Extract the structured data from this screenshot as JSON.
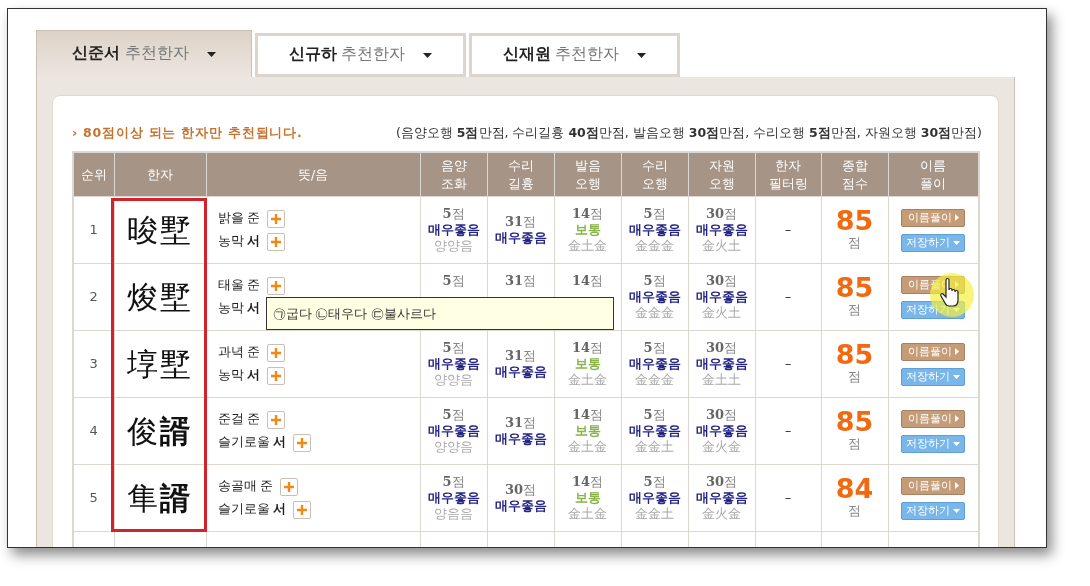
{
  "tabs": [
    {
      "label": "**신준서** 추천한자",
      "selected": true
    },
    {
      "label": "**신규하** 추천한자",
      "selected": false
    },
    {
      "label": "**신재원** 추천한자",
      "selected": false
    }
  ],
  "notice": "› 80점이상 되는 한자만 추천됩니다.",
  "score_legend": "(음양오행 **5점**만점, 수리길흉 **40점**만점, 발음오행 **30점**만점, 수리오행 **5점**만점, 자원오행 **30점**만점)",
  "table": {
    "columns": [
      {
        "label": "순위"
      },
      {
        "label": "한자"
      },
      {
        "label": "뜻/음"
      },
      {
        "label": "음양\n조화"
      },
      {
        "label": "수리\n길흉"
      },
      {
        "label": "발음\n오행"
      },
      {
        "label": "수리\n오행"
      },
      {
        "label": "자원\n오행"
      },
      {
        "label": "한자\n필터링"
      },
      {
        "label": "종합\n점수"
      },
      {
        "label": "이름\n풀이"
      }
    ],
    "hanja_highlight": true,
    "rows": [
      {
        "rank": "1",
        "hanja": "晙墅",
        "hovered": false,
        "meanings": [
          {
            "text": "밝을 준",
            "plus": true
          },
          {
            "text": "농막 **서**",
            "plus": true
          }
        ],
        "ratings": [
          {
            "score": "**5**점",
            "grade": "매우좋음",
            "color": "#262685",
            "element": "양양음"
          },
          {
            "score": "**31**점",
            "grade": "매우좋음",
            "color": "#262685"
          },
          {
            "score": "**14**점",
            "grade": "보통",
            "color": "#8ab34c",
            "element": "金土金"
          },
          {
            "score": "**5**점",
            "grade": "매우좋음",
            "color": "#262685",
            "element": "金金金"
          },
          {
            "score": "**30**점",
            "grade": "매우좋음",
            "color": "#262685",
            "element": "金火土"
          }
        ],
        "filter": "–",
        "total": "85",
        "total_unit": "점",
        "buttons": [
          {
            "label": "이름풀이",
            "kind": "detail"
          },
          {
            "label": "저장하기",
            "kind": "save"
          }
        ]
      },
      {
        "rank": "2",
        "hanja": "焌墅",
        "hovered": true,
        "meanings": [
          {
            "text": "태울 준",
            "plus": true
          },
          {
            "text": "농막 **서**",
            "plus": false
          }
        ],
        "tooltip": "㉠굽다 ㉡태우다 ㉢불사르다",
        "ratings": [
          {
            "score": "**5**점"
          },
          {
            "score": "**31**점"
          },
          {
            "score": "**14**점"
          },
          {
            "score": "**5**점",
            "grade": "매우좋음",
            "color": "#262685",
            "element": "金金金"
          },
          {
            "score": "**30**점",
            "grade": "매우좋음",
            "color": "#262685",
            "element": "金火土"
          }
        ],
        "filter": "–",
        "total": "85",
        "total_unit": "점",
        "buttons": [
          {
            "label": "이름풀이",
            "kind": "detail"
          },
          {
            "label": "저장하기",
            "kind": "save"
          }
        ]
      },
      {
        "rank": "3",
        "hanja": "埻墅",
        "hovered": false,
        "meanings": [
          {
            "text": "과녁 준",
            "plus": true
          },
          {
            "text": "농막 **서**",
            "plus": true
          }
        ],
        "ratings": [
          {
            "score": "**5**점",
            "grade": "매우좋음",
            "color": "#262685",
            "element": "양양음"
          },
          {
            "score": "**31**점",
            "grade": "매우좋음",
            "color": "#262685"
          },
          {
            "score": "**14**점",
            "grade": "보통",
            "color": "#8ab34c",
            "element": "金土金"
          },
          {
            "score": "**5**점",
            "grade": "매우좋음",
            "color": "#262685",
            "element": "金金金"
          },
          {
            "score": "**30**점",
            "grade": "매우좋음",
            "color": "#262685",
            "element": "金土土"
          }
        ],
        "filter": "–",
        "total": "85",
        "total_unit": "점",
        "buttons": [
          {
            "label": "이름풀이",
            "kind": "detail"
          },
          {
            "label": "저장하기",
            "kind": "save"
          }
        ]
      },
      {
        "rank": "4",
        "hanja": "俊**諝**",
        "hovered": false,
        "meanings": [
          {
            "text": "준걸 준",
            "plus": true
          },
          {
            "text": "슬기로울 **서**",
            "plus": true
          }
        ],
        "ratings": [
          {
            "score": "**5**점",
            "grade": "매우좋음",
            "color": "#262685",
            "element": "양양음"
          },
          {
            "score": "**31**점",
            "grade": "매우좋음",
            "color": "#262685"
          },
          {
            "score": "**14**점",
            "grade": "보통",
            "color": "#8ab34c",
            "element": "金土金"
          },
          {
            "score": "**5**점",
            "grade": "매우좋음",
            "color": "#262685",
            "element": "金金土"
          },
          {
            "score": "**30**점",
            "grade": "매우좋음",
            "color": "#262685",
            "element": "金火金"
          }
        ],
        "filter": "–",
        "total": "85",
        "total_unit": "점",
        "buttons": [
          {
            "label": "이름풀이",
            "kind": "detail"
          },
          {
            "label": "저장하기",
            "kind": "save"
          }
        ]
      },
      {
        "rank": "5",
        "hanja": "隼**諝**",
        "hovered": false,
        "meanings": [
          {
            "text": "송골매 준",
            "plus": true
          },
          {
            "text": "슬기로울 **서**",
            "plus": true
          }
        ],
        "ratings": [
          {
            "score": "**5**점",
            "grade": "매우좋음",
            "color": "#262685",
            "element": "양음음"
          },
          {
            "score": "**30**점",
            "grade": "매우좋음",
            "color": "#262685"
          },
          {
            "score": "**14**점",
            "grade": "보통",
            "color": "#8ab34c",
            "element": "金土金"
          },
          {
            "score": "**5**점",
            "grade": "매우좋음",
            "color": "#262685",
            "element": "金金土"
          },
          {
            "score": "**30**점",
            "grade": "매우좋음",
            "color": "#262685",
            "element": "金火金"
          }
        ],
        "filter": "–",
        "total": "84",
        "total_unit": "점",
        "buttons": [
          {
            "label": "이름풀이",
            "kind": "detail"
          },
          {
            "label": "저장하기",
            "kind": "save"
          }
        ]
      },
      {
        "empty": true
      }
    ]
  }
}
